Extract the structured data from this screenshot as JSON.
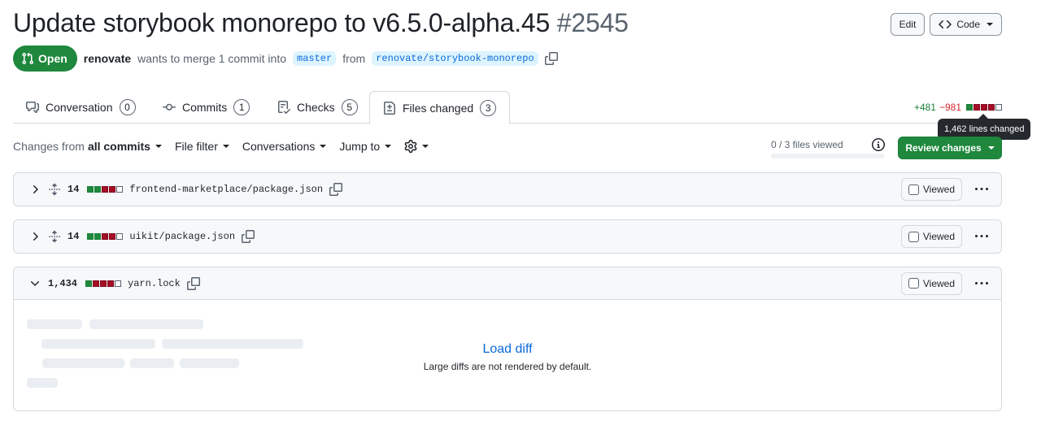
{
  "header": {
    "title": "Update storybook monorepo to v6.5.0-alpha.45",
    "number": "#2545",
    "edit_label": "Edit",
    "code_label": "Code"
  },
  "meta": {
    "state": "Open",
    "author": "renovate",
    "summary": "wants to merge 1 commit into",
    "base_branch": "master",
    "from_text": "from",
    "head_branch": "renovate/storybook-monorepo"
  },
  "tabs": [
    {
      "label": "Conversation",
      "count": "0",
      "icon": "comment-discussion-icon"
    },
    {
      "label": "Commits",
      "count": "1",
      "icon": "git-commit-icon"
    },
    {
      "label": "Checks",
      "count": "5",
      "icon": "checklist-icon"
    },
    {
      "label": "Files changed",
      "count": "3",
      "icon": "file-diff-icon"
    }
  ],
  "diffstat": {
    "additions": "+481",
    "deletions": "−981",
    "blocks": [
      "green",
      "red",
      "red",
      "red",
      "neutral"
    ],
    "tooltip": "1,462 lines changed"
  },
  "toolbar": {
    "changes_from_prefix": "Changes from",
    "changes_from_value": "all commits",
    "file_filter": "File filter",
    "conversations": "Conversations",
    "jump_to": "Jump to",
    "files_viewed": "0 / 3 files viewed",
    "files_viewed_fraction": 0,
    "review_changes": "Review changes"
  },
  "files": [
    {
      "count": "14",
      "name": "frontend-marketplace/package.json",
      "viewed_label": "Viewed",
      "expanded": false,
      "blocks": [
        "green",
        "green",
        "red",
        "red",
        "neutral"
      ]
    },
    {
      "count": "14",
      "name": "uikit/package.json",
      "viewed_label": "Viewed",
      "expanded": false,
      "blocks": [
        "green",
        "green",
        "red",
        "red",
        "neutral"
      ]
    },
    {
      "count": "1,434",
      "name": "yarn.lock",
      "viewed_label": "Viewed",
      "expanded": true,
      "blocks": [
        "green",
        "red",
        "red",
        "red",
        "neutral"
      ]
    }
  ],
  "load_diff": {
    "link": "Load diff",
    "note": "Large diffs are not rendered by default."
  },
  "colors": {
    "accent": "#0969da",
    "success": "#1f883d",
    "danger": "#d1242f"
  }
}
